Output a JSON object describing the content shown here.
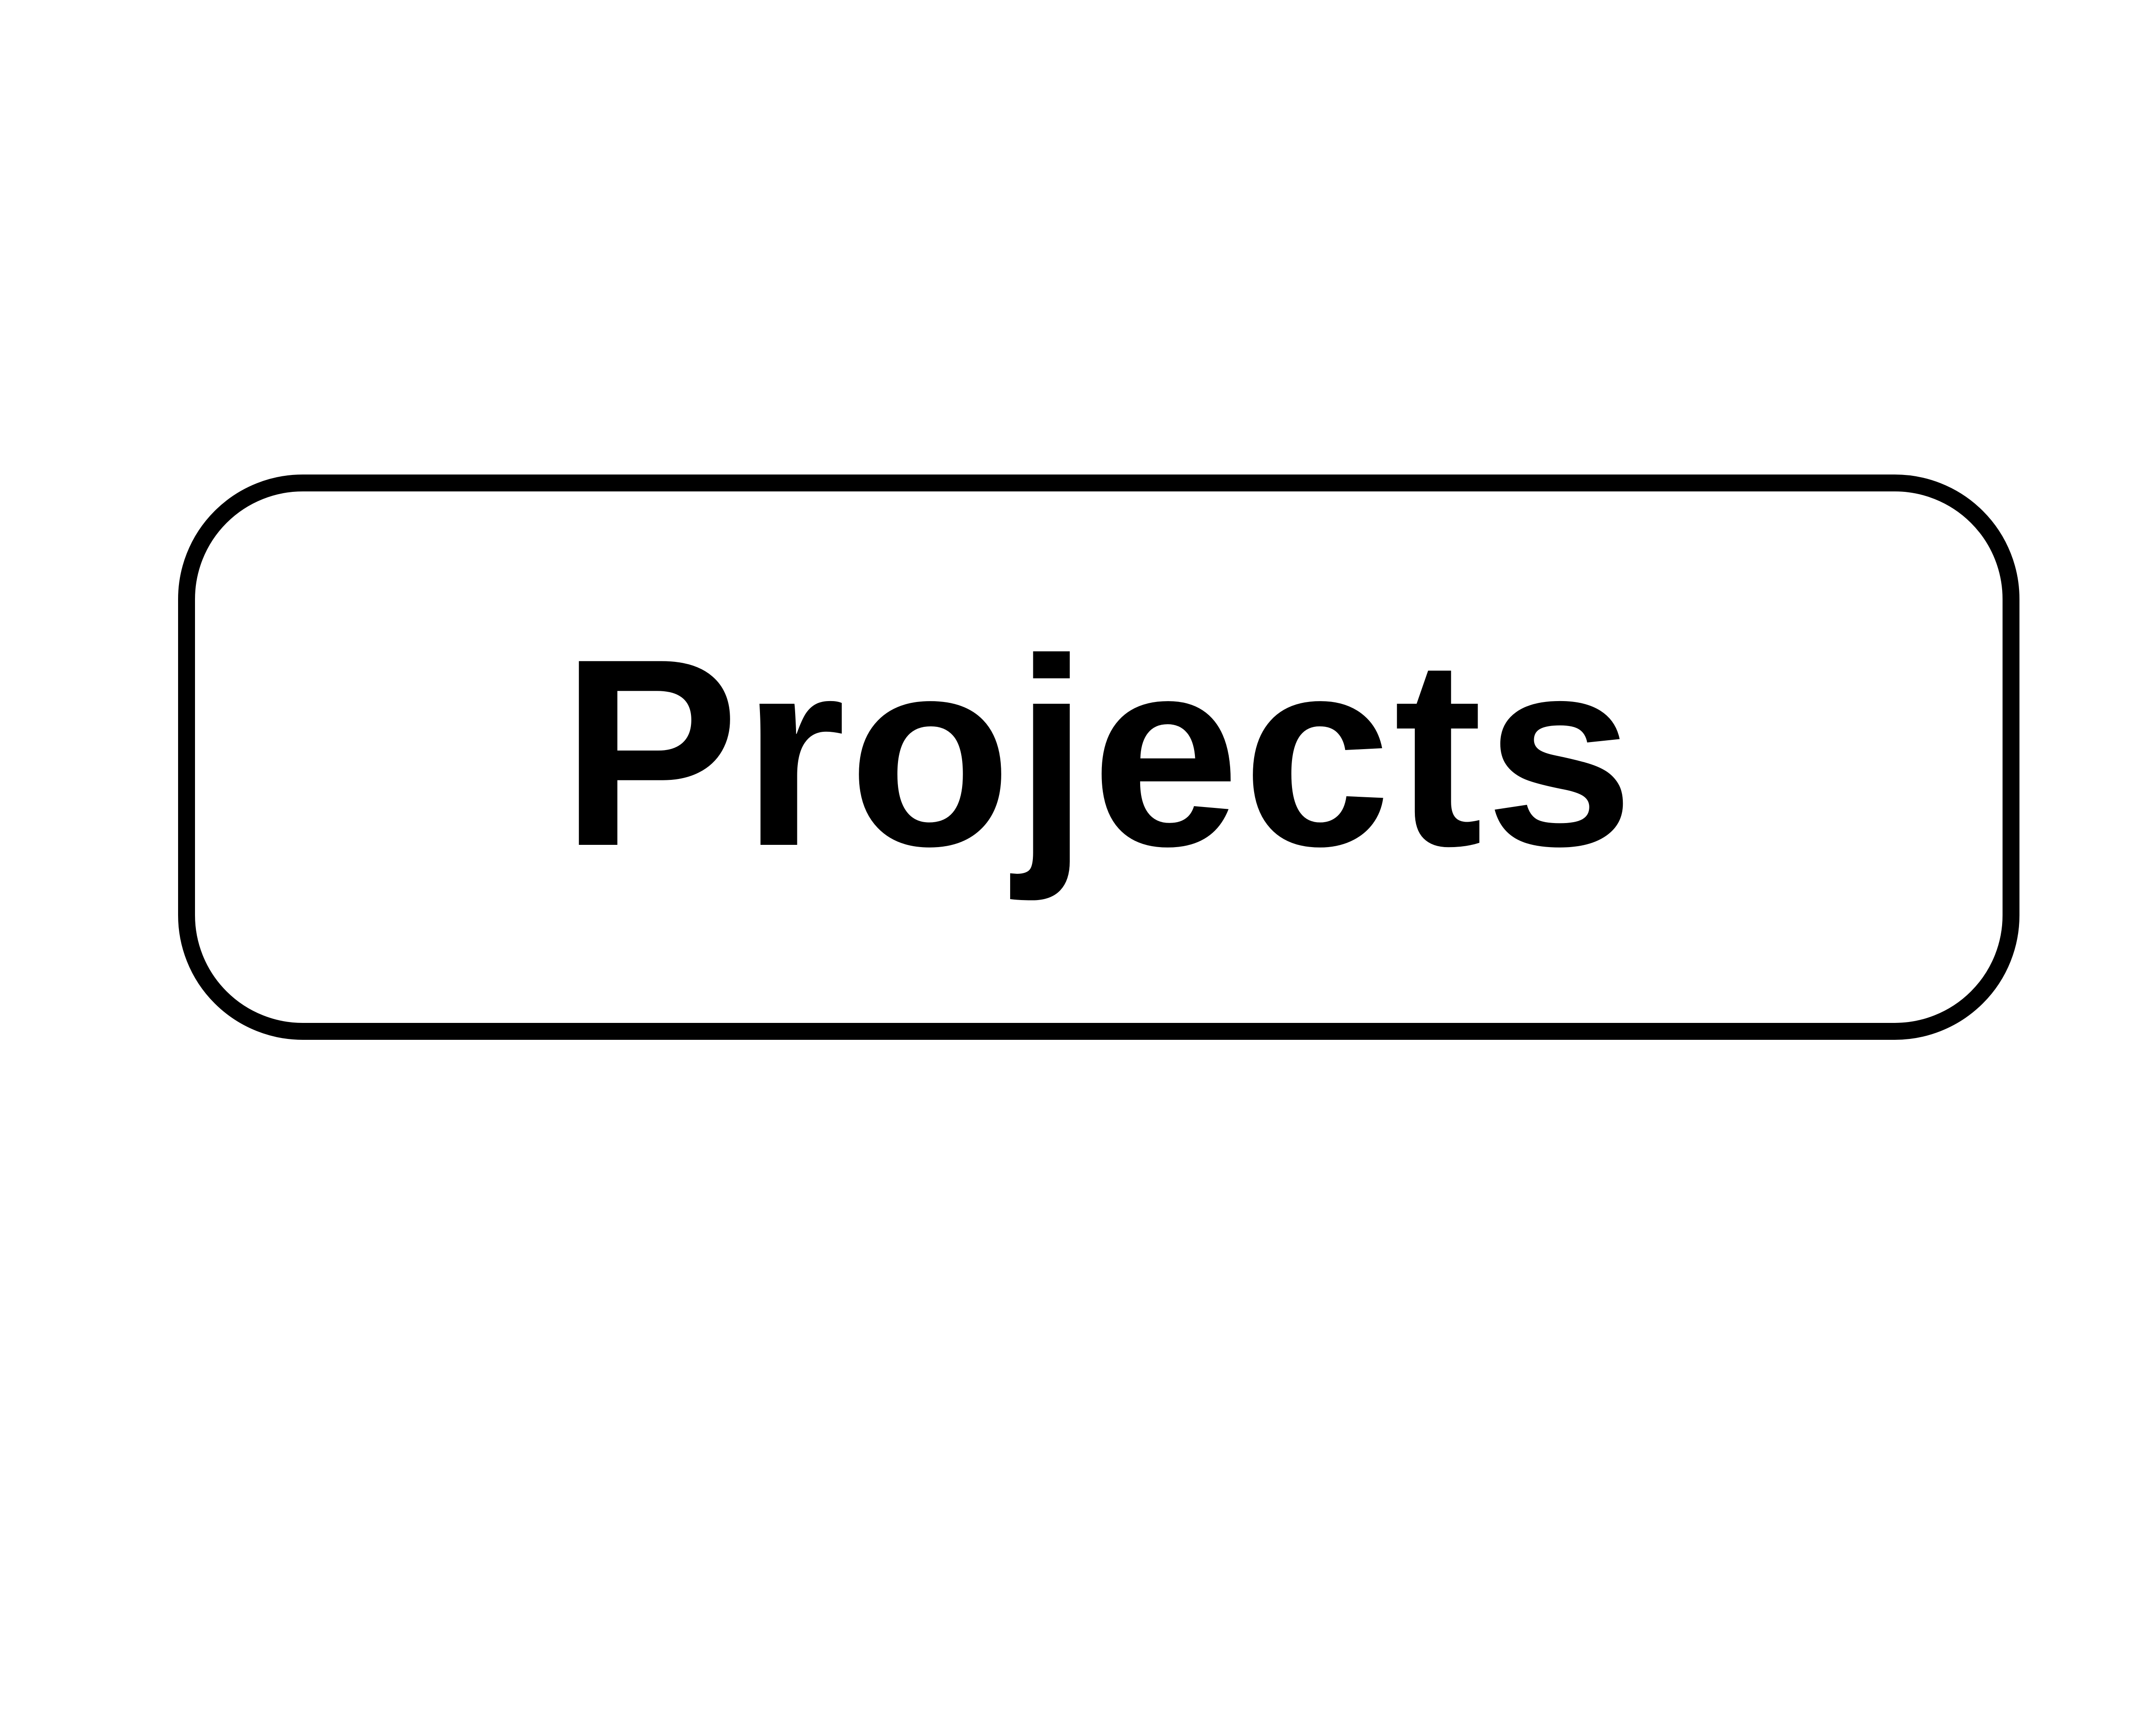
{
  "button": {
    "label": "Projects",
    "border_color": "#000000",
    "text_color": "#000000",
    "background_color": "#ffffff"
  }
}
